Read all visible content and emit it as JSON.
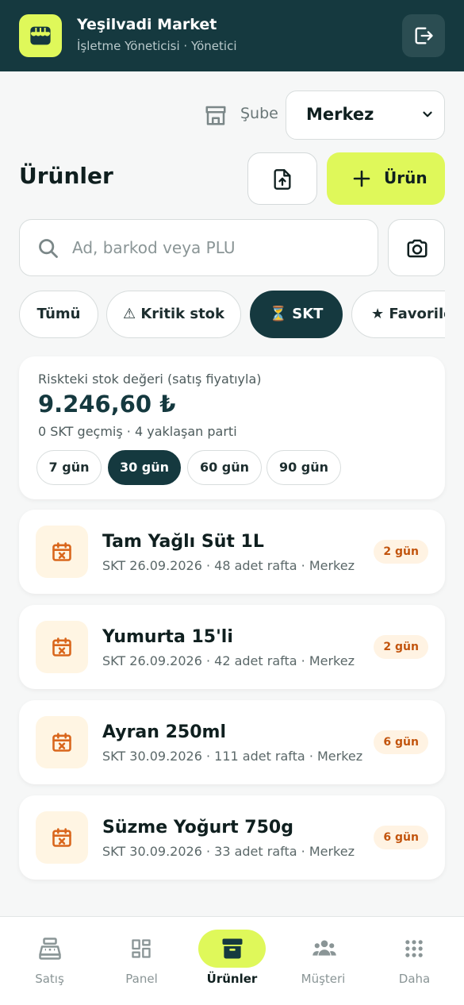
{
  "header": {
    "store_name": "Yeşilvadi Market",
    "role": "İşletme Yöneticisi · Yönetici",
    "logo_icon": "store-icon",
    "logout_icon": "logout-icon"
  },
  "branch": {
    "label": "Şube",
    "selected": "Merkez"
  },
  "page": {
    "title": "Ürünler",
    "add_button_label": "Ürün"
  },
  "search": {
    "placeholder": "Ad, barkod veya PLU",
    "value": ""
  },
  "filter_chips": [
    {
      "label": "Tümü",
      "active": false
    },
    {
      "label": "⚠ Kritik stok",
      "active": false
    },
    {
      "label": "⏳ SKT",
      "active": true
    },
    {
      "label": "★ Favoriler",
      "active": false
    }
  ],
  "risk": {
    "label": "Riskteki stok değeri (satış fiyatıyla)",
    "value": "9.246,60 ₺",
    "subtext": "0 SKT geçmiş · 4 yaklaşan parti",
    "periods": [
      {
        "label": "7 gün",
        "active": false
      },
      {
        "label": "30 gün",
        "active": true
      },
      {
        "label": "60 gün",
        "active": false
      },
      {
        "label": "90 gün",
        "active": false
      }
    ]
  },
  "items": [
    {
      "name": "Tam Yağlı Süt 1L",
      "meta": "SKT 26.09.2026 · 48 adet rafta · Merkez",
      "badge": "2 gün"
    },
    {
      "name": "Yumurta 15'li",
      "meta": "SKT 26.09.2026 · 42 adet rafta · Merkez",
      "badge": "2 gün"
    },
    {
      "name": "Ayran 250ml",
      "meta": "SKT 30.09.2026 · 111 adet rafta · Merkez",
      "badge": "6 gün"
    },
    {
      "name": "Süzme Yoğurt 750g",
      "meta": "SKT 30.09.2026 · 33 adet rafta · Merkez",
      "badge": "6 gün"
    }
  ],
  "nav": [
    {
      "label": "Satış",
      "icon": "cash-register-icon",
      "active": false
    },
    {
      "label": "Panel",
      "icon": "dashboard-icon",
      "active": false
    },
    {
      "label": "Ürünler",
      "icon": "archive-box-icon",
      "active": true
    },
    {
      "label": "Müşteri",
      "icon": "users-icon",
      "active": false
    },
    {
      "label": "Daha",
      "icon": "grid-dots-icon",
      "active": false
    }
  ],
  "colors": {
    "primary_dark": "#15393f",
    "accent_lime": "#dff85a",
    "warning_orange": "#c2540d"
  }
}
